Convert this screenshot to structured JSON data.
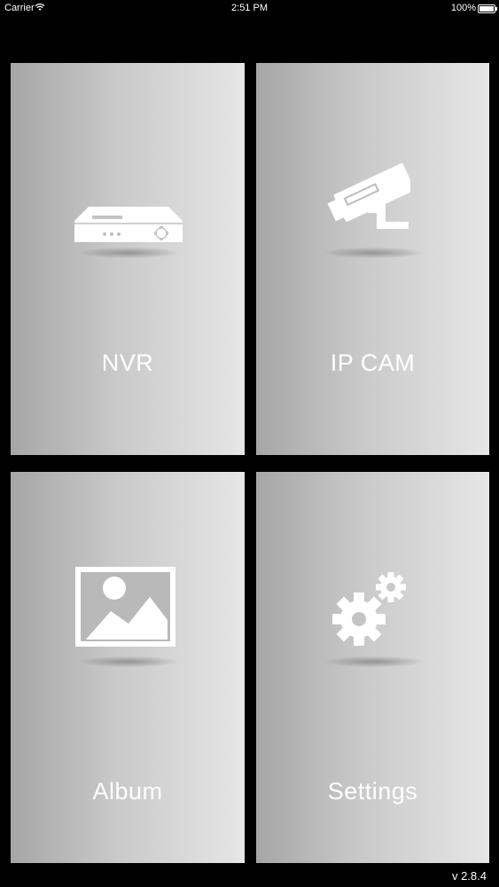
{
  "status_bar": {
    "carrier": "Carrier",
    "wifi_icon": "wifi-icon",
    "time": "2:51 PM",
    "battery_percent": "100%",
    "battery_icon": "battery-icon"
  },
  "tiles": [
    {
      "label": "NVR",
      "icon": "nvr-icon"
    },
    {
      "label": "IP CAM",
      "icon": "ip-camera-icon"
    },
    {
      "label": "Album",
      "icon": "image-icon"
    },
    {
      "label": "Settings",
      "icon": "gears-icon"
    }
  ],
  "version": "v 2.8.4",
  "colors": {
    "background": "#000000",
    "tile_gradient_start": "#a6a6a6",
    "tile_gradient_end": "#e6e6e6",
    "icon_and_text": "#ffffff"
  }
}
